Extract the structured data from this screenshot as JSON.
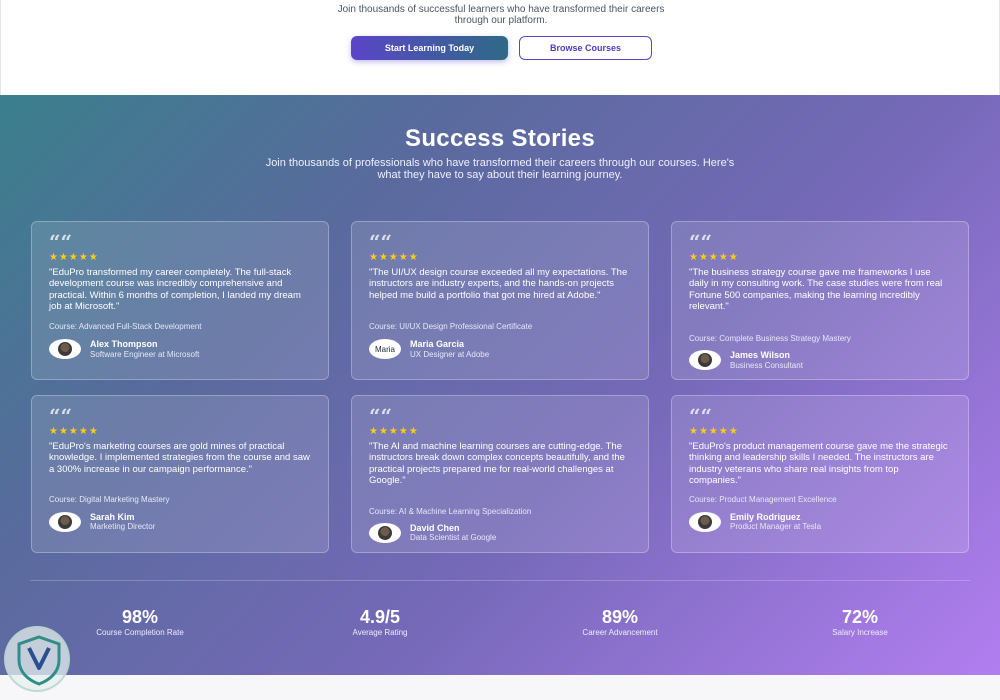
{
  "hero": {
    "subtitle_line1": "Join thousands of successful learners who have transformed their careers",
    "subtitle_line2": "through our platform.",
    "primary_button": "Start Learning Today",
    "secondary_button": "Browse Courses"
  },
  "stories": {
    "title": "Success Stories",
    "description": "Join thousands of professionals who have transformed their careers through our courses. Here's what they have to say about their learning journey.",
    "quote_symbol": "““",
    "stars": "★★★★★",
    "cards": [
      {
        "quote": "\"EduPro transformed my career completely. The full-stack development course was incredibly comprehensive and practical. Within 6 months of completion, I landed my dream job at Microsoft.\"",
        "course": "Course: Advanced Full-Stack Development",
        "name": "Alex Thompson",
        "role": "Software Engineer at Microsoft"
      },
      {
        "quote": "\"The UI/UX design course exceeded all my expectations. The instructors are industry experts, and the hands-on projects helped me build a portfolio that got me hired at Adobe.\"",
        "course": "Course: UI/UX Design Professional Certificate",
        "name": "Maria Garcia",
        "role": "UX Designer at Adobe",
        "avatar_text": "Maria"
      },
      {
        "quote": "\"The business strategy course gave me frameworks I use daily in my consulting work. The case studies were from real Fortune 500 companies, making the learning incredibly relevant.\"",
        "course": "Course: Complete Business Strategy Mastery",
        "name": "James Wilson",
        "role": "Business Consultant"
      },
      {
        "quote": "\"EduPro's marketing courses are gold mines of practical knowledge. I implemented strategies from the course and saw a 300% increase in our campaign performance.\"",
        "course": "Course: Digital Marketing Mastery",
        "name": "Sarah Kim",
        "role": "Marketing Director"
      },
      {
        "quote": "\"The AI and machine learning courses are cutting-edge. The instructors break down complex concepts beautifully, and the practical projects prepared me for real-world challenges at Google.\"",
        "course": "Course: AI & Machine Learning Specialization",
        "name": "David Chen",
        "role": "Data Scientist at Google"
      },
      {
        "quote": "\"EduPro's product management course gave me the strategic thinking and leadership skills I needed. The instructors are industry veterans who share real insights from top companies.\"",
        "course": "Course: Product Management Excellence",
        "name": "Emily Rodriguez",
        "role": "Product Manager at Tesla"
      }
    ]
  },
  "stats": [
    {
      "value": "98%",
      "label": "Course Completion Rate"
    },
    {
      "value": "4.9/5",
      "label": "Average Rating"
    },
    {
      "value": "89%",
      "label": "Career Advancement"
    },
    {
      "value": "72%",
      "label": "Salary Increase"
    }
  ],
  "colors": {
    "primary": "#5b45c8",
    "star": "#facc15"
  }
}
